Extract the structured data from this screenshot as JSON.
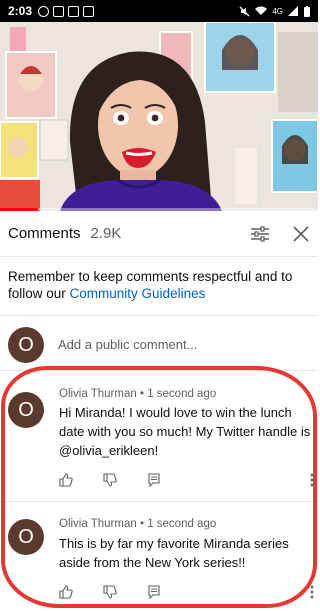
{
  "status_bar": {
    "time": "2:03",
    "network": "4G",
    "left_icons": [
      "pinterest-icon",
      "instagram-icon",
      "instagram-icon",
      "gallery-icon"
    ],
    "right_icons": [
      "mute-icon",
      "wifi-icon",
      "signal-icon",
      "battery-icon"
    ]
  },
  "video": {
    "progress_fraction": 0.12,
    "accent_color": "#ff0000"
  },
  "comments_header": {
    "title": "Comments",
    "count": "2.9K"
  },
  "notice": {
    "text": "Remember to keep comments respectful and to follow our ",
    "link": "Community Guidelines"
  },
  "add_comment": {
    "avatar_letter": "O",
    "placeholder": "Add a public comment..."
  },
  "comments": [
    {
      "avatar_letter": "O",
      "author": "Olivia Thurman",
      "time": "1 second ago",
      "text": "Hi Miranda! I would love to win the lunch date with you so much! My Twitter handle is @olivia_erikleen!"
    },
    {
      "avatar_letter": "O",
      "author": "Olivia Thurman",
      "time": "1 second ago",
      "text": "This is by far my favorite Miranda series aside from the New York series!!"
    }
  ],
  "colors": {
    "avatar": "#5b3a2e",
    "link": "#065fd4",
    "annotation": "#e53935"
  }
}
